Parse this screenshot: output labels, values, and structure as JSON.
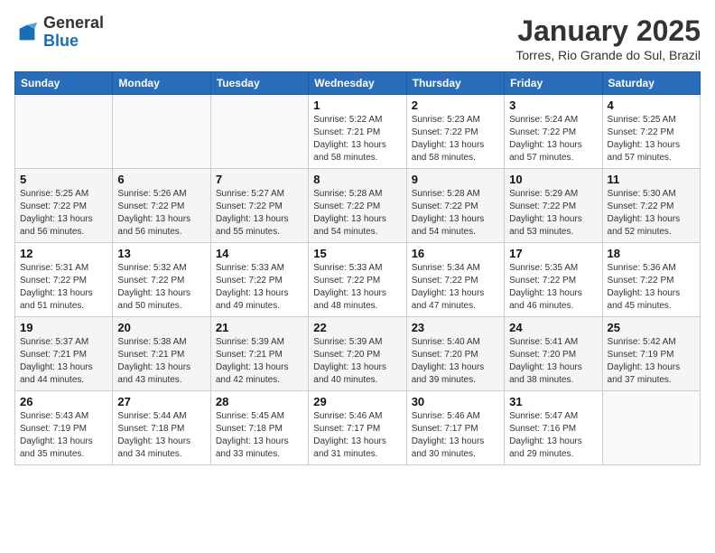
{
  "header": {
    "logo_line1": "General",
    "logo_line2": "Blue",
    "month_title": "January 2025",
    "location": "Torres, Rio Grande do Sul, Brazil"
  },
  "weekdays": [
    "Sunday",
    "Monday",
    "Tuesday",
    "Wednesday",
    "Thursday",
    "Friday",
    "Saturday"
  ],
  "weeks": [
    [
      {
        "day": "",
        "info": ""
      },
      {
        "day": "",
        "info": ""
      },
      {
        "day": "",
        "info": ""
      },
      {
        "day": "1",
        "info": "Sunrise: 5:22 AM\nSunset: 7:21 PM\nDaylight: 13 hours\nand 58 minutes."
      },
      {
        "day": "2",
        "info": "Sunrise: 5:23 AM\nSunset: 7:22 PM\nDaylight: 13 hours\nand 58 minutes."
      },
      {
        "day": "3",
        "info": "Sunrise: 5:24 AM\nSunset: 7:22 PM\nDaylight: 13 hours\nand 57 minutes."
      },
      {
        "day": "4",
        "info": "Sunrise: 5:25 AM\nSunset: 7:22 PM\nDaylight: 13 hours\nand 57 minutes."
      }
    ],
    [
      {
        "day": "5",
        "info": "Sunrise: 5:25 AM\nSunset: 7:22 PM\nDaylight: 13 hours\nand 56 minutes."
      },
      {
        "day": "6",
        "info": "Sunrise: 5:26 AM\nSunset: 7:22 PM\nDaylight: 13 hours\nand 56 minutes."
      },
      {
        "day": "7",
        "info": "Sunrise: 5:27 AM\nSunset: 7:22 PM\nDaylight: 13 hours\nand 55 minutes."
      },
      {
        "day": "8",
        "info": "Sunrise: 5:28 AM\nSunset: 7:22 PM\nDaylight: 13 hours\nand 54 minutes."
      },
      {
        "day": "9",
        "info": "Sunrise: 5:28 AM\nSunset: 7:22 PM\nDaylight: 13 hours\nand 54 minutes."
      },
      {
        "day": "10",
        "info": "Sunrise: 5:29 AM\nSunset: 7:22 PM\nDaylight: 13 hours\nand 53 minutes."
      },
      {
        "day": "11",
        "info": "Sunrise: 5:30 AM\nSunset: 7:22 PM\nDaylight: 13 hours\nand 52 minutes."
      }
    ],
    [
      {
        "day": "12",
        "info": "Sunrise: 5:31 AM\nSunset: 7:22 PM\nDaylight: 13 hours\nand 51 minutes."
      },
      {
        "day": "13",
        "info": "Sunrise: 5:32 AM\nSunset: 7:22 PM\nDaylight: 13 hours\nand 50 minutes."
      },
      {
        "day": "14",
        "info": "Sunrise: 5:33 AM\nSunset: 7:22 PM\nDaylight: 13 hours\nand 49 minutes."
      },
      {
        "day": "15",
        "info": "Sunrise: 5:33 AM\nSunset: 7:22 PM\nDaylight: 13 hours\nand 48 minutes."
      },
      {
        "day": "16",
        "info": "Sunrise: 5:34 AM\nSunset: 7:22 PM\nDaylight: 13 hours\nand 47 minutes."
      },
      {
        "day": "17",
        "info": "Sunrise: 5:35 AM\nSunset: 7:22 PM\nDaylight: 13 hours\nand 46 minutes."
      },
      {
        "day": "18",
        "info": "Sunrise: 5:36 AM\nSunset: 7:22 PM\nDaylight: 13 hours\nand 45 minutes."
      }
    ],
    [
      {
        "day": "19",
        "info": "Sunrise: 5:37 AM\nSunset: 7:21 PM\nDaylight: 13 hours\nand 44 minutes."
      },
      {
        "day": "20",
        "info": "Sunrise: 5:38 AM\nSunset: 7:21 PM\nDaylight: 13 hours\nand 43 minutes."
      },
      {
        "day": "21",
        "info": "Sunrise: 5:39 AM\nSunset: 7:21 PM\nDaylight: 13 hours\nand 42 minutes."
      },
      {
        "day": "22",
        "info": "Sunrise: 5:39 AM\nSunset: 7:20 PM\nDaylight: 13 hours\nand 40 minutes."
      },
      {
        "day": "23",
        "info": "Sunrise: 5:40 AM\nSunset: 7:20 PM\nDaylight: 13 hours\nand 39 minutes."
      },
      {
        "day": "24",
        "info": "Sunrise: 5:41 AM\nSunset: 7:20 PM\nDaylight: 13 hours\nand 38 minutes."
      },
      {
        "day": "25",
        "info": "Sunrise: 5:42 AM\nSunset: 7:19 PM\nDaylight: 13 hours\nand 37 minutes."
      }
    ],
    [
      {
        "day": "26",
        "info": "Sunrise: 5:43 AM\nSunset: 7:19 PM\nDaylight: 13 hours\nand 35 minutes."
      },
      {
        "day": "27",
        "info": "Sunrise: 5:44 AM\nSunset: 7:18 PM\nDaylight: 13 hours\nand 34 minutes."
      },
      {
        "day": "28",
        "info": "Sunrise: 5:45 AM\nSunset: 7:18 PM\nDaylight: 13 hours\nand 33 minutes."
      },
      {
        "day": "29",
        "info": "Sunrise: 5:46 AM\nSunset: 7:17 PM\nDaylight: 13 hours\nand 31 minutes."
      },
      {
        "day": "30",
        "info": "Sunrise: 5:46 AM\nSunset: 7:17 PM\nDaylight: 13 hours\nand 30 minutes."
      },
      {
        "day": "31",
        "info": "Sunrise: 5:47 AM\nSunset: 7:16 PM\nDaylight: 13 hours\nand 29 minutes."
      },
      {
        "day": "",
        "info": ""
      }
    ]
  ]
}
